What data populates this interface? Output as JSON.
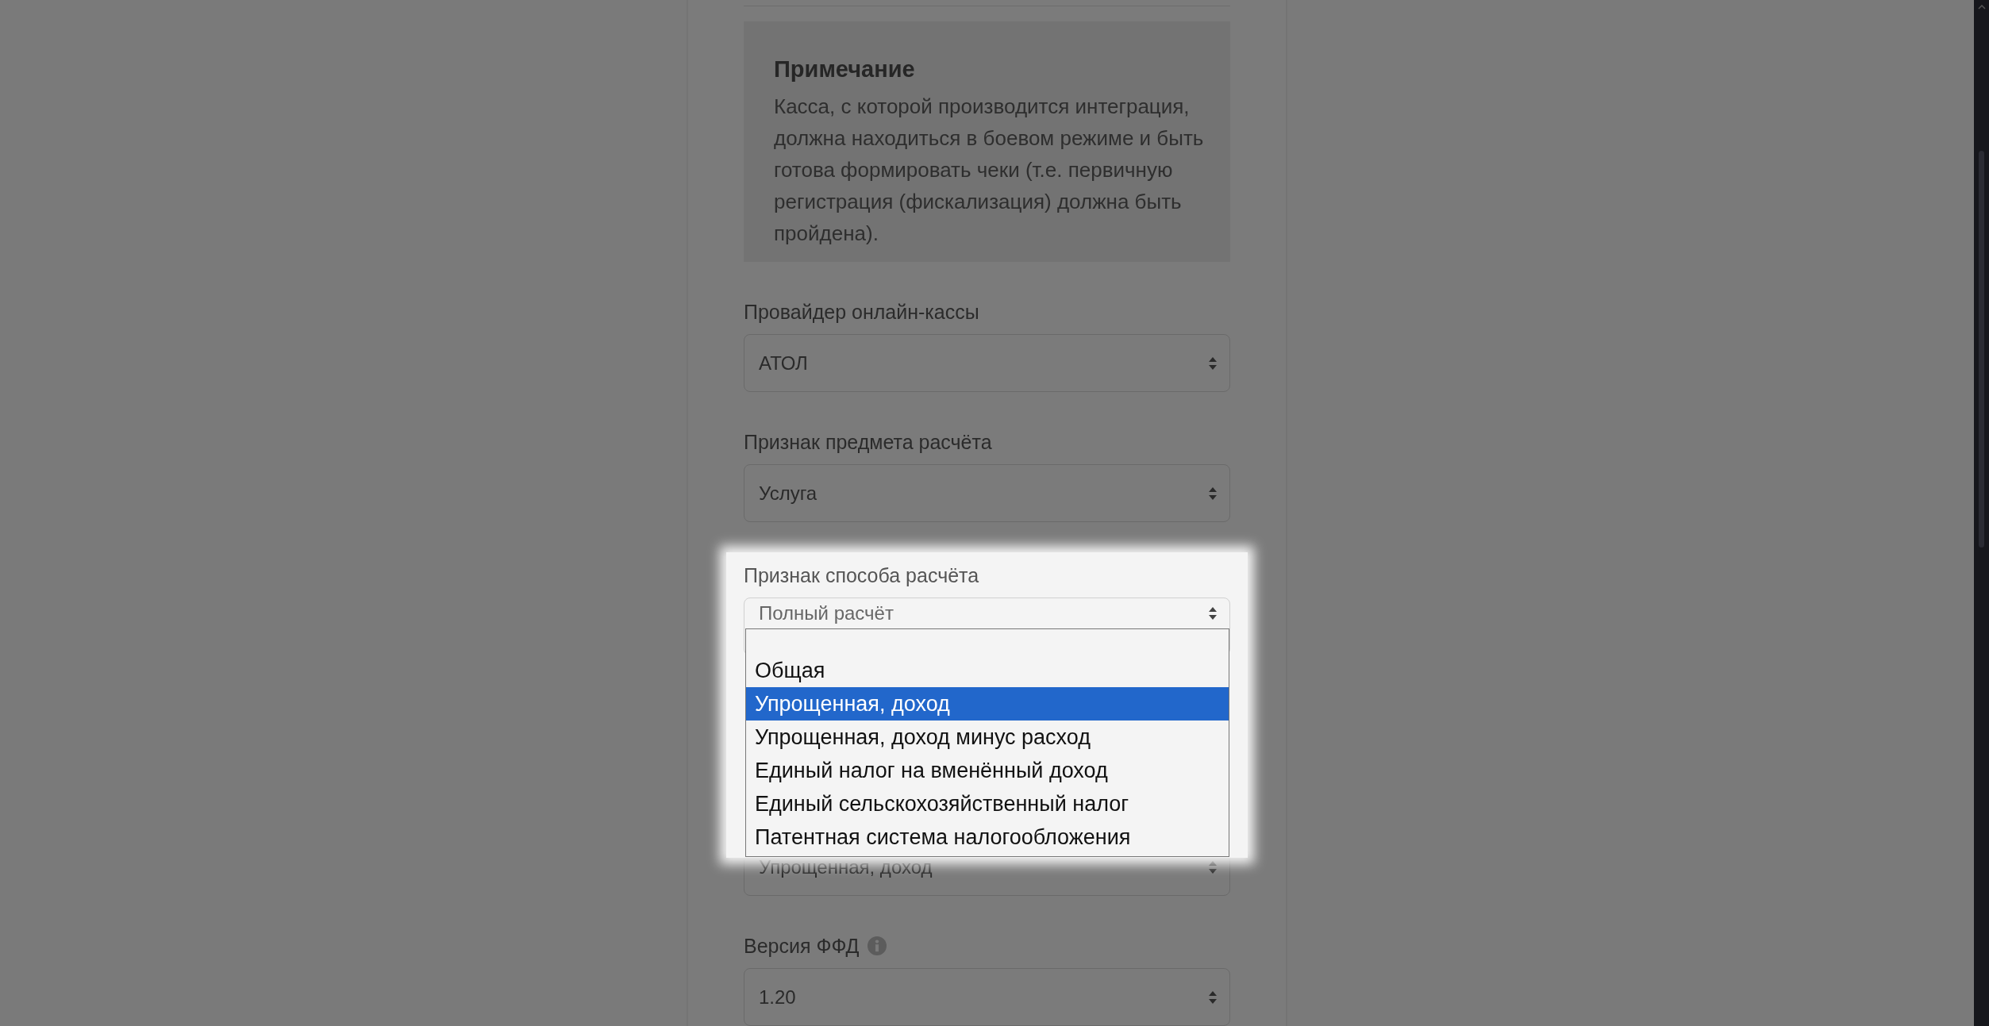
{
  "note": {
    "title": "Примечание",
    "text": "Касса, с которой производится интеграция, должна находиться в боевом режиме и быть готова формировать чеки (т.е. первичную регистрация (фискализация) должна быть пройдена)."
  },
  "fields": [
    {
      "label": "Провайдер онлайн-кассы",
      "value": "АТОЛ",
      "info": false
    },
    {
      "label": "Признак предмета расчёта",
      "value": "Услуга",
      "info": false
    }
  ],
  "focused_field": {
    "label": "Признак способа расчёта",
    "value": "Полный расчёт"
  },
  "dropdown": {
    "options": [
      {
        "label": "Общая",
        "selected": false
      },
      {
        "label": "Упрощенная, доход",
        "selected": true
      },
      {
        "label": "Упрощенная, доход минус расход",
        "selected": false
      },
      {
        "label": "Единый налог на вменённый доход",
        "selected": false
      },
      {
        "label": "Единый сельскохозяйственный налог",
        "selected": false
      },
      {
        "label": "Патентная система налогообложения",
        "selected": false
      }
    ]
  },
  "lower_fields": [
    {
      "value": "Упрощенная, доход"
    },
    {
      "label": "Версия ФФД",
      "value": "1.20",
      "info": true
    }
  ]
}
